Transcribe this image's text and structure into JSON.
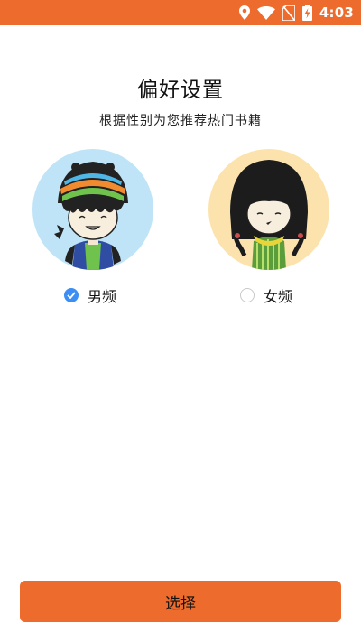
{
  "status_bar": {
    "time": "4:03",
    "icons": [
      "location-icon",
      "wifi-icon",
      "no-sim-icon",
      "battery-charging-icon"
    ],
    "background": "#ec6b2d"
  },
  "header": {
    "title": "偏好设置",
    "subtitle": "根据性别为您推荐热门书籍"
  },
  "options": [
    {
      "label": "男频",
      "selected": true,
      "avatar": "boy-avatar"
    },
    {
      "label": "女频",
      "selected": false,
      "avatar": "girl-avatar"
    }
  ],
  "actions": {
    "select_label": "选择"
  },
  "colors": {
    "accent": "#ec6b2d",
    "radio_checked": "#3a8ef6",
    "avatar_male_bg": "#bfe4f7",
    "avatar_female_bg": "#fce3ae"
  }
}
